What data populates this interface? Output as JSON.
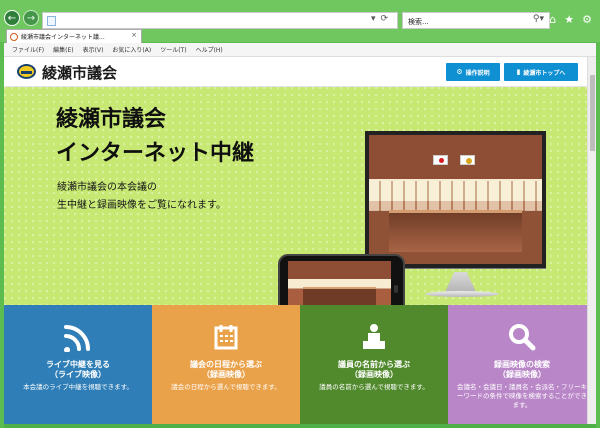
{
  "browser": {
    "search_label": "検索...",
    "tab_title": "綾瀬市議会インターネット議..."
  },
  "menu": {
    "items": [
      "ファイル(F)",
      "編集(E)",
      "表示(V)",
      "お気に入り(A)",
      "ツール(T)",
      "ヘルプ(H)"
    ]
  },
  "header": {
    "site_title": "綾瀬市議会",
    "guide_label": "操作説明",
    "top_label": "綾瀬市トップへ"
  },
  "hero": {
    "title": "綾瀬市議会\nインターネット中継",
    "description": "綾瀬市議会の本会議の\n生中継と録画映像をご覧になれます。"
  },
  "tiles": [
    {
      "title": "ライブ中継を見る\n（ライブ映像）",
      "description": "本会議のライブ中継を視聴できます。",
      "icon": "broadcast-icon",
      "color": "#2f7eb7"
    },
    {
      "title": "議会の日程から選ぶ\n（録画映像）",
      "description": "議会の日程から選んで視聴できます。",
      "icon": "calendar-icon",
      "color": "#eaa24a"
    },
    {
      "title": "議員の名前から選ぶ\n（録画映像）",
      "description": "議員の名前から選んで視聴できます。",
      "icon": "speaker-icon",
      "color": "#518a2d"
    },
    {
      "title": "録画映像の検索\n（録画映像）",
      "description": "会議名・会議日・議員名・会派名・フリーキーワードの条件で映像を検索することができます。",
      "icon": "search-icon",
      "color": "#b987c8"
    }
  ]
}
